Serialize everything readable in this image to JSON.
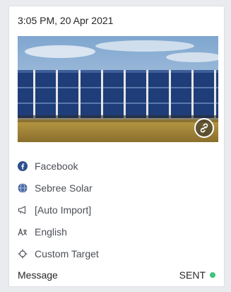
{
  "post": {
    "timestamp": "3:05 PM, 20 Apr 2021",
    "image_alt": "solar-panels-field",
    "meta": [
      {
        "icon": "facebook-icon",
        "label": "Facebook"
      },
      {
        "icon": "globe-icon",
        "label": "Sebree Solar"
      },
      {
        "icon": "megaphone-icon",
        "label": "[Auto Import]"
      },
      {
        "icon": "language-icon",
        "label": "English"
      },
      {
        "icon": "target-icon",
        "label": "Custom Target"
      }
    ],
    "type_label": "Message",
    "status_label": "SENT",
    "status_color": "#3fc380"
  }
}
